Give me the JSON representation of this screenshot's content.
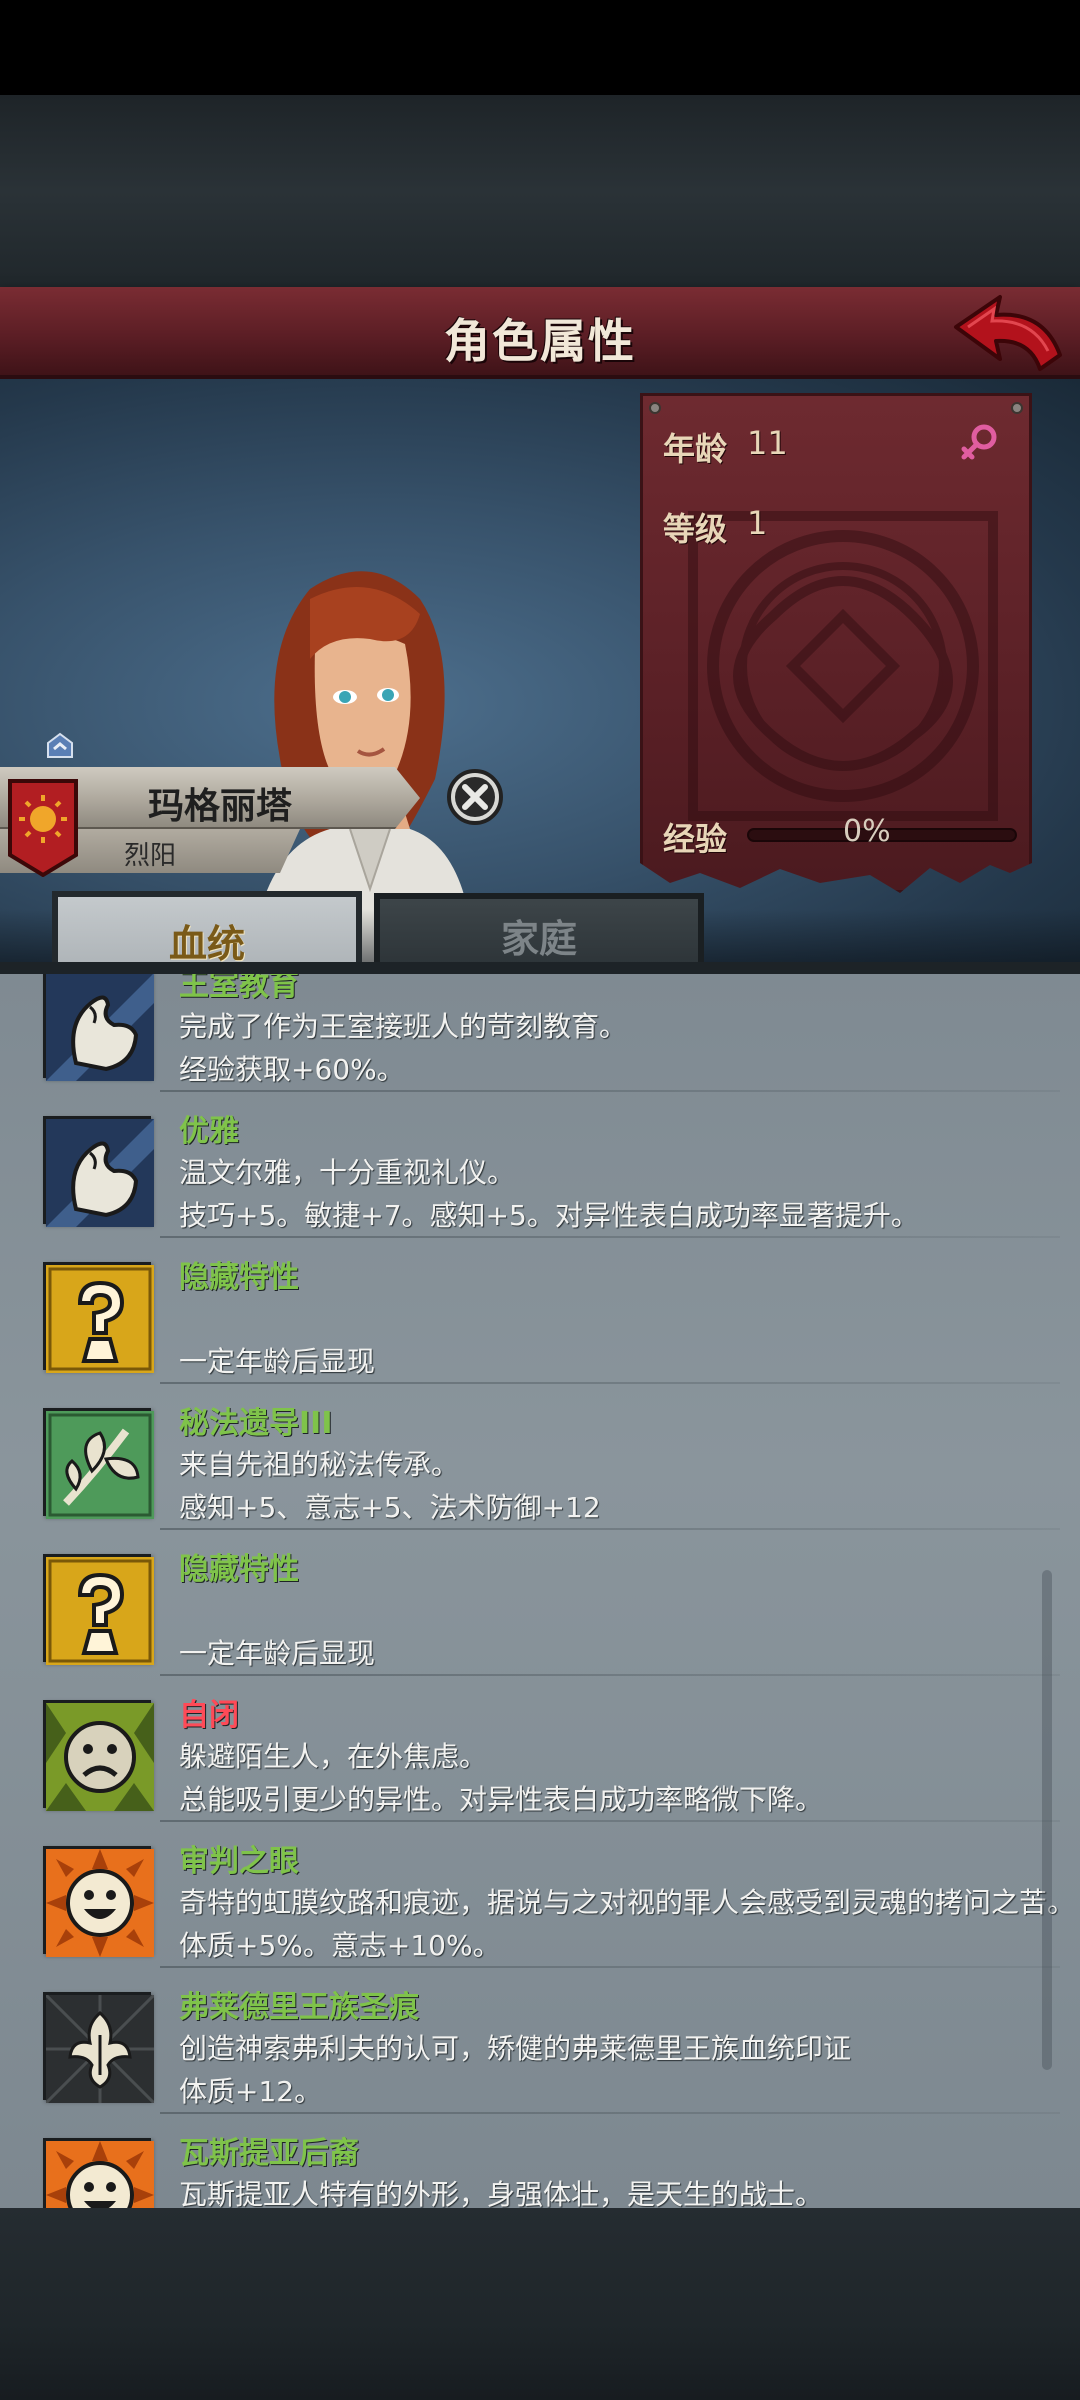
{
  "header": {
    "title": "角色属性",
    "back_icon": "back-arrow-icon"
  },
  "character": {
    "name": "玛格丽塔",
    "title": "烈阳",
    "banner_icon": "sun-banner-icon",
    "close_icon": "close-icon"
  },
  "stats": {
    "age_label": "年龄",
    "age_value": "11",
    "gender_icon": "female-icon",
    "level_label": "等级",
    "level_value": "1",
    "xp_label": "经验",
    "xp_value": "0%",
    "xp_progress": 0
  },
  "tabs": [
    {
      "label": "血统",
      "active": true
    },
    {
      "label": "家庭",
      "active": false
    }
  ],
  "traits": [
    {
      "name": "王室教育",
      "line1": "完成了作为王室接班人的苛刻教育。",
      "line2": "经验获取+60%。",
      "icon": "muscle-arm-icon",
      "name_color": "#7fc34a"
    },
    {
      "name": "优雅",
      "line1": "温文尔雅，十分重视礼仪。",
      "line2": "技巧+5。敏捷+7。感知+5。对异性表白成功率显著提升。",
      "icon": "muscle-arm-icon",
      "name_color": "#7fc34a"
    },
    {
      "name": "隐藏特性",
      "line1": "",
      "line2": "一定年龄后显现",
      "icon": "question-mark-icon",
      "name_color": "#7fc34a"
    },
    {
      "name": "秘法遗导III",
      "line1": "来自先祖的秘法传承。",
      "line2": "感知+5、意志+5、法术防御+12",
      "icon": "leaf-branch-icon",
      "name_color": "#7fc34a"
    },
    {
      "name": "隐藏特性",
      "line1": "",
      "line2": "一定年龄后显现",
      "icon": "question-mark-icon",
      "name_color": "#7fc34a"
    },
    {
      "name": "自闭",
      "line1": "躲避陌生人，在外焦虑。",
      "line2": "总能吸引更少的异性。对异性表白成功率略微下降。",
      "icon": "sad-face-icon",
      "name_color": "#ff4a57"
    },
    {
      "name": "审判之眼",
      "line1": "奇特的虹膜纹路和痕迹，据说与之对视的罪人会感受到灵魂的拷问之苦。",
      "line2": "体质+5%。意志+10%。",
      "icon": "happy-sun-face-icon",
      "name_color": "#7fc34a"
    },
    {
      "name": "弗莱德里王族圣痕",
      "line1": "创造神索弗利夫的认可，矫健的弗莱德里王族血统印证",
      "line2": "体质+12。",
      "icon": "royal-crest-icon",
      "name_color": "#7fc34a"
    },
    {
      "name": "瓦斯提亚后裔",
      "line1": "瓦斯提亚人特有的外形，身强体壮，是天生的战士。",
      "line2": "",
      "icon": "happy-sun-face-icon",
      "name_color": "#7fc34a"
    }
  ]
}
